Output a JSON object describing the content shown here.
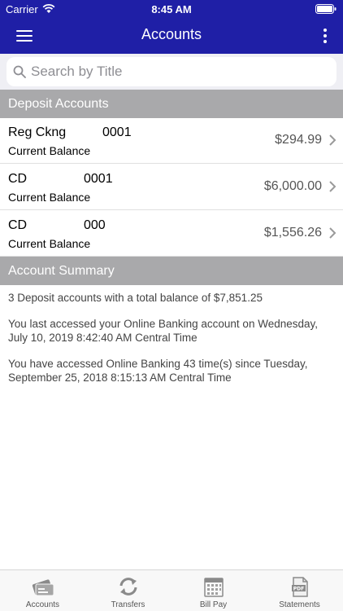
{
  "status_bar": {
    "carrier": "Carrier",
    "time": "8:45 AM"
  },
  "navbar": {
    "title": "Accounts"
  },
  "search": {
    "placeholder": "Search by Title",
    "value": ""
  },
  "deposit_section": {
    "title": "Deposit Accounts"
  },
  "accounts": [
    {
      "name": "Reg Ckng",
      "number": "0001",
      "label": "Current Balance",
      "balance": "$294.99"
    },
    {
      "name": "CD",
      "number": "0001",
      "label": "Current Balance",
      "balance": "$6,000.00"
    },
    {
      "name": "CD",
      "number": "000",
      "label": "Current Balance",
      "balance": "$1,556.26"
    }
  ],
  "summary_section": {
    "title": "Account Summary"
  },
  "summary": {
    "total_line": "3 Deposit accounts with a total balance of $7,851.25",
    "last_access": "You last accessed your Online Banking account on Wednesday, July 10, 2019 8:42:40 AM Central Time",
    "access_count": "You have accessed Online Banking 43 time(s) since Tuesday, September 25, 2018 8:15:13 AM Central Time"
  },
  "tabs": [
    {
      "label": "Accounts",
      "icon": "accounts-icon"
    },
    {
      "label": "Transfers",
      "icon": "transfers-icon"
    },
    {
      "label": "Bill Pay",
      "icon": "calendar-icon"
    },
    {
      "label": "Statements",
      "icon": "pdf-icon"
    }
  ],
  "colors": {
    "nav_bar": "#1f1fa6",
    "section_header": "#a9a9ab",
    "tab_icon": "#8a8a8a"
  }
}
